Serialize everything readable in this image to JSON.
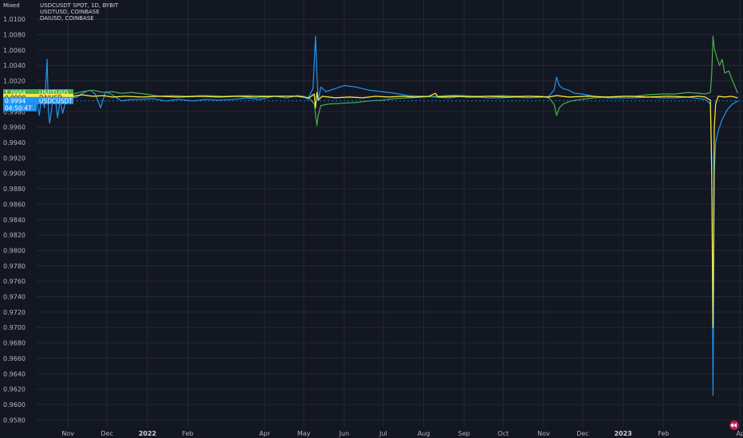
{
  "scale_mode": "Mixed",
  "legend": [
    "USDCUSDT SPOT, 1D, BYBIT",
    "USDTUSD, COINBASE",
    "DAIUSD, COINBASE"
  ],
  "colors": {
    "background": "#131722",
    "grid": "#242834",
    "axis_text": "#b2b5be",
    "USDCUSDT": "#2196f3",
    "USDTUSD": "#4caf50",
    "DAIUSD": "#ffeb3b"
  },
  "price_tags": [
    {
      "value": "1.0004",
      "label": "USDTUSD",
      "series": "USDTUSD"
    },
    {
      "value": "0.9998",
      "label": "DAIUSD",
      "series": "DAIUSD"
    },
    {
      "value": "0.9994",
      "label": "USDCUSDT",
      "series": "USDCUSDT"
    }
  ],
  "countdown": "04:50:47",
  "chart_data": {
    "type": "line",
    "ylim": [
      0.957,
      1.0125
    ],
    "y_ticks": [
      "1.0100",
      "1.0080",
      "1.0060",
      "1.0040",
      "1.0020",
      "1.0000",
      "0.9980",
      "0.9960",
      "0.9940",
      "0.9920",
      "0.9900",
      "0.9880",
      "0.9860",
      "0.9840",
      "0.9820",
      "0.9800",
      "0.9780",
      "0.9760",
      "0.9740",
      "0.9720",
      "0.9700",
      "0.9680",
      "0.9660",
      "0.9640",
      "0.9620",
      "0.9600",
      "0.9580"
    ],
    "x_ticks": [
      {
        "label": "Nov",
        "date": "2021-11-01"
      },
      {
        "label": "Dec",
        "date": "2021-12-01"
      },
      {
        "label": "2022",
        "date": "2022-01-01",
        "bold": true
      },
      {
        "label": "Feb",
        "date": "2022-02-01"
      },
      {
        "label": "Apr",
        "date": "2022-04-01"
      },
      {
        "label": "May",
        "date": "2022-05-01"
      },
      {
        "label": "Jun",
        "date": "2022-06-01"
      },
      {
        "label": "Jul",
        "date": "2022-07-01"
      },
      {
        "label": "Aug",
        "date": "2022-08-01"
      },
      {
        "label": "Sep",
        "date": "2022-09-01"
      },
      {
        "label": "Oct",
        "date": "2022-10-01"
      },
      {
        "label": "Nov",
        "date": "2022-11-01"
      },
      {
        "label": "Dec",
        "date": "2022-12-01"
      },
      {
        "label": "2023",
        "date": "2023-01-01",
        "bold": true
      },
      {
        "label": "Feb",
        "date": "2023-02-01"
      },
      {
        "label": "Ap",
        "date": "2023-04-01"
      }
    ],
    "series": [
      {
        "name": "USDCUSDT",
        "color": "#2196f3",
        "points": [
          [
            "2021-10-08",
            0.9995
          ],
          [
            "2021-10-10",
            0.9975
          ],
          [
            "2021-10-12",
            1.0005
          ],
          [
            "2021-10-14",
            0.9985
          ],
          [
            "2021-10-16",
            1.0048
          ],
          [
            "2021-10-17",
            0.998
          ],
          [
            "2021-10-18",
            0.9965
          ],
          [
            "2021-10-20",
            0.999
          ],
          [
            "2021-10-22",
            1.0002
          ],
          [
            "2021-10-24",
            0.9972
          ],
          [
            "2021-10-26",
            0.9995
          ],
          [
            "2021-10-28",
            0.9978
          ],
          [
            "2021-10-30",
            0.9992
          ],
          [
            "2021-11-03",
            1.0
          ],
          [
            "2021-11-07",
            0.9998
          ],
          [
            "2021-11-12",
            1.0004
          ],
          [
            "2021-11-18",
            1.0008
          ],
          [
            "2021-11-22",
            1.0003
          ],
          [
            "2021-11-26",
            0.9985
          ],
          [
            "2021-11-30",
            1.0006
          ],
          [
            "2021-12-05",
            1.0002
          ],
          [
            "2021-12-12",
            0.9994
          ],
          [
            "2021-12-20",
            0.9996
          ],
          [
            "2021-12-28",
            0.9996
          ],
          [
            "2022-01-05",
            0.9997
          ],
          [
            "2022-01-15",
            0.9994
          ],
          [
            "2022-01-25",
            0.9996
          ],
          [
            "2022-02-05",
            0.9994
          ],
          [
            "2022-02-15",
            0.9996
          ],
          [
            "2022-02-25",
            0.9995
          ],
          [
            "2022-03-08",
            0.9996
          ],
          [
            "2022-03-18",
            0.9998
          ],
          [
            "2022-03-28",
            0.9996
          ],
          [
            "2022-04-08",
            1.0
          ],
          [
            "2022-04-18",
            0.9998
          ],
          [
            "2022-04-26",
            1.0001
          ],
          [
            "2022-05-01",
            1.0
          ],
          [
            "2022-05-04",
            0.9996
          ],
          [
            "2022-05-08",
            1.001
          ],
          [
            "2022-05-10",
            1.0078
          ],
          [
            "2022-05-11",
            1.003
          ],
          [
            "2022-05-12",
            0.9994
          ],
          [
            "2022-05-14",
            1.0012
          ],
          [
            "2022-05-18",
            1.0006
          ],
          [
            "2022-05-25",
            1.001
          ],
          [
            "2022-06-01",
            1.0014
          ],
          [
            "2022-06-10",
            1.0012
          ],
          [
            "2022-06-20",
            1.0008
          ],
          [
            "2022-06-30",
            1.0006
          ],
          [
            "2022-07-10",
            1.0004
          ],
          [
            "2022-07-20",
            1.0001
          ],
          [
            "2022-07-31",
            1.0
          ],
          [
            "2022-08-10",
            0.9999
          ],
          [
            "2022-08-20",
            0.9998
          ],
          [
            "2022-08-31",
            1.0
          ],
          [
            "2022-09-10",
            0.9999
          ],
          [
            "2022-09-20",
            0.9998
          ],
          [
            "2022-09-30",
            0.9998
          ],
          [
            "2022-10-10",
            0.9999
          ],
          [
            "2022-10-20",
            0.9998
          ],
          [
            "2022-10-31",
            0.9999
          ],
          [
            "2022-11-05",
            1.0
          ],
          [
            "2022-11-09",
            1.0008
          ],
          [
            "2022-11-11",
            1.0025
          ],
          [
            "2022-11-13",
            1.0014
          ],
          [
            "2022-11-16",
            1.001
          ],
          [
            "2022-11-20",
            1.0008
          ],
          [
            "2022-11-25",
            1.0004
          ],
          [
            "2022-11-30",
            1.0003
          ],
          [
            "2022-12-10",
            1.0
          ],
          [
            "2022-12-20",
            0.9998
          ],
          [
            "2022-12-31",
            0.9998
          ],
          [
            "2023-01-10",
            0.9998
          ],
          [
            "2023-01-20",
            0.9999
          ],
          [
            "2023-01-31",
            0.9998
          ],
          [
            "2023-02-10",
            0.9998
          ],
          [
            "2023-02-20",
            0.9999
          ],
          [
            "2023-02-28",
            0.9997
          ],
          [
            "2023-03-05",
            0.9996
          ],
          [
            "2023-03-09",
            0.999
          ],
          [
            "2023-03-10",
            0.992
          ],
          [
            "2023-03-11",
            0.9612
          ],
          [
            "2023-03-12",
            0.99
          ],
          [
            "2023-03-13",
            0.994
          ],
          [
            "2023-03-15",
            0.9955
          ],
          [
            "2023-03-18",
            0.997
          ],
          [
            "2023-03-22",
            0.9983
          ],
          [
            "2023-03-26",
            0.999
          ],
          [
            "2023-03-30",
            0.9994
          ]
        ]
      },
      {
        "name": "USDTUSD",
        "color": "#4caf50",
        "points": [
          [
            "2021-10-08",
            0.9998
          ],
          [
            "2021-10-12",
            1.0002
          ],
          [
            "2021-10-18",
            1.0
          ],
          [
            "2021-10-24",
            1.0001
          ],
          [
            "2021-10-30",
            1.0
          ],
          [
            "2021-11-05",
            1.0003
          ],
          [
            "2021-11-12",
            1.0006
          ],
          [
            "2021-11-20",
            1.0008
          ],
          [
            "2021-11-28",
            1.0005
          ],
          [
            "2021-12-05",
            1.0006
          ],
          [
            "2021-12-12",
            1.0004
          ],
          [
            "2021-12-20",
            1.0005
          ],
          [
            "2021-12-30",
            1.0003
          ],
          [
            "2022-01-10",
            1.0
          ],
          [
            "2022-01-20",
            1.0001
          ],
          [
            "2022-02-01",
            1.0
          ],
          [
            "2022-02-15",
            1.0001
          ],
          [
            "2022-03-01",
            1.0
          ],
          [
            "2022-03-20",
            1.0001
          ],
          [
            "2022-04-10",
            1.0
          ],
          [
            "2022-04-26",
            1.0
          ],
          [
            "2022-05-05",
            0.9998
          ],
          [
            "2022-05-09",
            0.999
          ],
          [
            "2022-05-11",
            0.9962
          ],
          [
            "2022-05-12",
            0.9975
          ],
          [
            "2022-05-14",
            0.9988
          ],
          [
            "2022-05-20",
            0.999
          ],
          [
            "2022-05-30",
            0.9991
          ],
          [
            "2022-06-10",
            0.9992
          ],
          [
            "2022-06-20",
            0.9994
          ],
          [
            "2022-06-30",
            0.9995
          ],
          [
            "2022-07-10",
            0.9997
          ],
          [
            "2022-07-20",
            0.9998
          ],
          [
            "2022-07-31",
            0.9999
          ],
          [
            "2022-08-10",
            1.0
          ],
          [
            "2022-08-20",
            1.0001
          ],
          [
            "2022-08-31",
            1.0001
          ],
          [
            "2022-09-10",
            1.0
          ],
          [
            "2022-09-20",
            1.0
          ],
          [
            "2022-09-30",
            1.0001
          ],
          [
            "2022-10-10",
            1.0
          ],
          [
            "2022-10-20",
            1.0
          ],
          [
            "2022-10-31",
            1.0
          ],
          [
            "2022-11-05",
            0.9998
          ],
          [
            "2022-11-09",
            0.999
          ],
          [
            "2022-11-11",
            0.9975
          ],
          [
            "2022-11-13",
            0.9985
          ],
          [
            "2022-11-16",
            0.999
          ],
          [
            "2022-11-22",
            0.9994
          ],
          [
            "2022-11-30",
            0.9996
          ],
          [
            "2022-12-10",
            0.9998
          ],
          [
            "2022-12-20",
            0.9999
          ],
          [
            "2022-12-31",
            1.0
          ],
          [
            "2023-01-10",
            1.0
          ],
          [
            "2023-01-20",
            1.0002
          ],
          [
            "2023-01-31",
            1.0003
          ],
          [
            "2023-02-10",
            1.0003
          ],
          [
            "2023-02-20",
            1.0005
          ],
          [
            "2023-02-28",
            1.0004
          ],
          [
            "2023-03-05",
            1.0003
          ],
          [
            "2023-03-09",
            1.0005
          ],
          [
            "2023-03-10",
            1.003
          ],
          [
            "2023-03-11",
            1.0078
          ],
          [
            "2023-03-12",
            1.0062
          ],
          [
            "2023-03-14",
            1.005
          ],
          [
            "2023-03-16",
            1.004
          ],
          [
            "2023-03-18",
            1.0048
          ],
          [
            "2023-03-20",
            1.003
          ],
          [
            "2023-03-23",
            1.0033
          ],
          [
            "2023-03-26",
            1.002
          ],
          [
            "2023-03-30",
            1.0004
          ]
        ]
      },
      {
        "name": "DAIUSD",
        "color": "#ffeb3b",
        "points": [
          [
            "2021-10-08",
            0.9998
          ],
          [
            "2021-10-12",
            1.0
          ],
          [
            "2021-10-18",
            0.9996
          ],
          [
            "2021-10-24",
            1.0001
          ],
          [
            "2021-10-30",
            0.9998
          ],
          [
            "2021-11-05",
            1.0
          ],
          [
            "2021-11-12",
            1.0002
          ],
          [
            "2021-11-20",
            1.0
          ],
          [
            "2021-11-28",
            1.0001
          ],
          [
            "2021-12-05",
            0.9999
          ],
          [
            "2021-12-15",
            1.0
          ],
          [
            "2021-12-28",
            0.9999
          ],
          [
            "2022-01-10",
            1.0
          ],
          [
            "2022-01-25",
            0.9999
          ],
          [
            "2022-02-10",
            1.0
          ],
          [
            "2022-02-25",
            0.9999
          ],
          [
            "2022-03-10",
            1.0
          ],
          [
            "2022-03-25",
            0.9999
          ],
          [
            "2022-04-10",
            1.0
          ],
          [
            "2022-04-26",
            1.0
          ],
          [
            "2022-05-05",
            0.9998
          ],
          [
            "2022-05-09",
            1.0003
          ],
          [
            "2022-05-10",
            0.9985
          ],
          [
            "2022-05-11",
            1.0005
          ],
          [
            "2022-05-12",
            0.9995
          ],
          [
            "2022-05-15",
            1.0
          ],
          [
            "2022-05-25",
            0.9998
          ],
          [
            "2022-06-05",
            0.9999
          ],
          [
            "2022-06-15",
            0.9998
          ],
          [
            "2022-06-25",
            1.0
          ],
          [
            "2022-07-05",
            0.9999
          ],
          [
            "2022-07-15",
            1.0
          ],
          [
            "2022-07-25",
            0.9999
          ],
          [
            "2022-08-05",
            1.0
          ],
          [
            "2022-08-10",
            1.0004
          ],
          [
            "2022-08-12",
            0.9999
          ],
          [
            "2022-08-25",
            1.0
          ],
          [
            "2022-09-05",
            0.9999
          ],
          [
            "2022-09-20",
            1.0
          ],
          [
            "2022-10-05",
            0.9999
          ],
          [
            "2022-10-20",
            1.0
          ],
          [
            "2022-11-05",
            0.9999
          ],
          [
            "2022-11-11",
            1.0001
          ],
          [
            "2022-11-20",
            0.9999
          ],
          [
            "2022-12-05",
            1.0
          ],
          [
            "2022-12-20",
            0.9999
          ],
          [
            "2023-01-05",
            1.0
          ],
          [
            "2023-01-20",
            0.9999
          ],
          [
            "2023-02-05",
            1.0
          ],
          [
            "2023-02-20",
            0.9999
          ],
          [
            "2023-02-28",
            1.0
          ],
          [
            "2023-03-05",
            0.9999
          ],
          [
            "2023-03-09",
            0.9995
          ],
          [
            "2023-03-10",
            0.99
          ],
          [
            "2023-03-11",
            0.97
          ],
          [
            "2023-03-12",
            0.996
          ],
          [
            "2023-03-13",
            0.999
          ],
          [
            "2023-03-15",
            1.0
          ],
          [
            "2023-03-20",
            0.9999
          ],
          [
            "2023-03-25",
            1.0
          ],
          [
            "2023-03-30",
            0.9998
          ]
        ]
      }
    ]
  }
}
